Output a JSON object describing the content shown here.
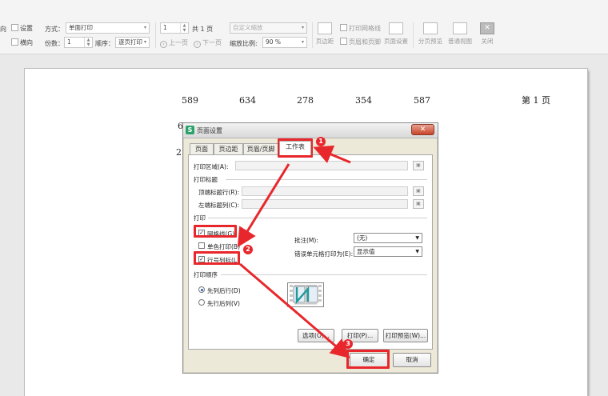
{
  "toolbar": {
    "partial_left_1": "向",
    "settings_label": "设置",
    "landscape_label": "横向",
    "method_label": "方式：",
    "method_value": "单面打印",
    "copies_label": "份数：",
    "copies_value": "1",
    "order_label": "顺序：",
    "order_value": "逐页打印",
    "page_value": "1",
    "total_pages": "共 1 页",
    "prev_page": "上一页",
    "next_page": "下一页",
    "custom_zoom": "自定义缩放",
    "zoom_label": "缩放比例:",
    "zoom_value": "90 %",
    "margins_label": "页边距",
    "print_gridlines": "打印网格线",
    "header_footer": "页眉和页脚",
    "page_setup": "页面设置",
    "page_break_preview": "分页预览",
    "normal_view": "普通视图",
    "close_label": "关闭"
  },
  "sheet": {
    "row1": [
      "589",
      "634",
      "278",
      "354",
      "587"
    ],
    "page_label": "第 1 页",
    "row2_partial": "6",
    "row3_partial": "2"
  },
  "dialog": {
    "title": "页面设置",
    "close_glyph": "✕",
    "tabs": [
      "页面",
      "页边距",
      "页眉/页脚",
      "工作表"
    ],
    "print_area_label": "打印区域(A):",
    "print_titles_label": "打印标题",
    "top_rows_label": "顶端标题行(R):",
    "left_cols_label": "左端标题列(C):",
    "print_group_label": "打印",
    "gridlines_label": "网格线(G)",
    "mono_label": "单色打印(B)",
    "row_col_label": "行号列标(L)",
    "comments_label": "批注(M):",
    "comments_value": "(无)",
    "errors_label": "错误单元格打印为(E):",
    "errors_value": "显示值",
    "order_group_label": "打印顺序",
    "down_then_over": "先列后行(D)",
    "over_then_down": "先行后列(V)",
    "options_button": "选项(O)...",
    "print_button": "打印(P)...",
    "preview_button": "打印预览(W)...",
    "ok_button": "确定",
    "cancel_button": "取消",
    "gridlines_checked": true,
    "row_col_checked": true
  },
  "annotations": {
    "badges": [
      "1",
      "2",
      "3"
    ],
    "color": "#e8272c"
  }
}
